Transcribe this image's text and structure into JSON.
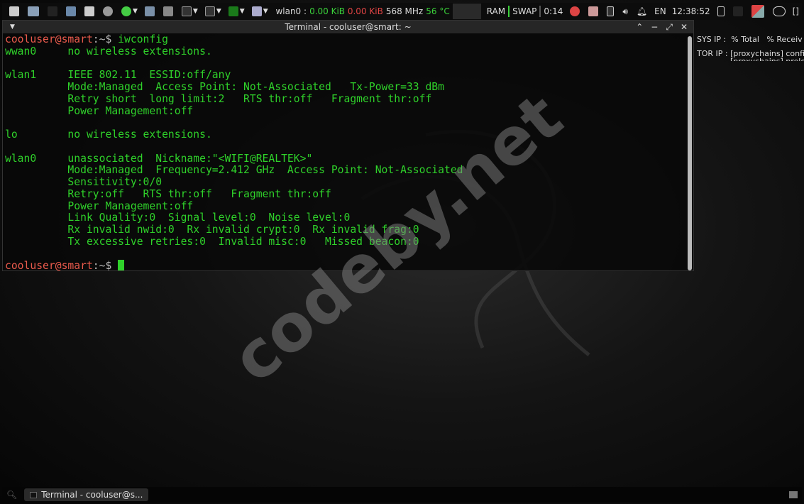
{
  "panel": {
    "net_iface": "wlan0 :",
    "net_down": "0.00 KiB",
    "net_up": "0.00 KiB",
    "cpu_freq": "568 MHz",
    "temp": "56 °C",
    "ram": "RAM",
    "swap": "SWAP",
    "battery_time": "0:14",
    "lang": "EN",
    "clock": "12:38:52",
    "bracket": "[]"
  },
  "terminal": {
    "title": "Terminal - cooluser@smart: ~",
    "prompt_user": "cooluser@smart",
    "prompt_path": ":~$",
    "command": "iwconfig",
    "lines": [
      "wwan0     no wireless extensions.",
      "",
      "wlan1     IEEE 802.11  ESSID:off/any",
      "          Mode:Managed  Access Point: Not-Associated   Tx-Power=33 dBm",
      "          Retry short  long limit:2   RTS thr:off   Fragment thr:off",
      "          Power Management:off",
      "",
      "lo        no wireless extensions.",
      "",
      "wlan0     unassociated  Nickname:\"<WIFI@REALTEK>\"",
      "          Mode:Managed  Frequency=2.412 GHz  Access Point: Not-Associated",
      "          Sensitivity:0/0",
      "          Retry:off   RTS thr:off   Fragment thr:off",
      "          Power Management:off",
      "          Link Quality:0  Signal level:0  Noise level:0",
      "          Rx invalid nwid:0  Rx invalid crypt:0  Rx invalid frag:0",
      "          Tx excessive retries:0  Invalid misc:0   Missed beacon:0",
      ""
    ]
  },
  "conky": {
    "sys_ip": "SYS IP :",
    "total": "% Total",
    "received": "% Receiv",
    "tor_ip": "TOR IP :",
    "tor_line1": "[proxychains] confi",
    "tor_line2": "[proxychains] prelo"
  },
  "watermark": "codeby.net",
  "taskbar": {
    "task": "Terminal - cooluser@s..."
  }
}
